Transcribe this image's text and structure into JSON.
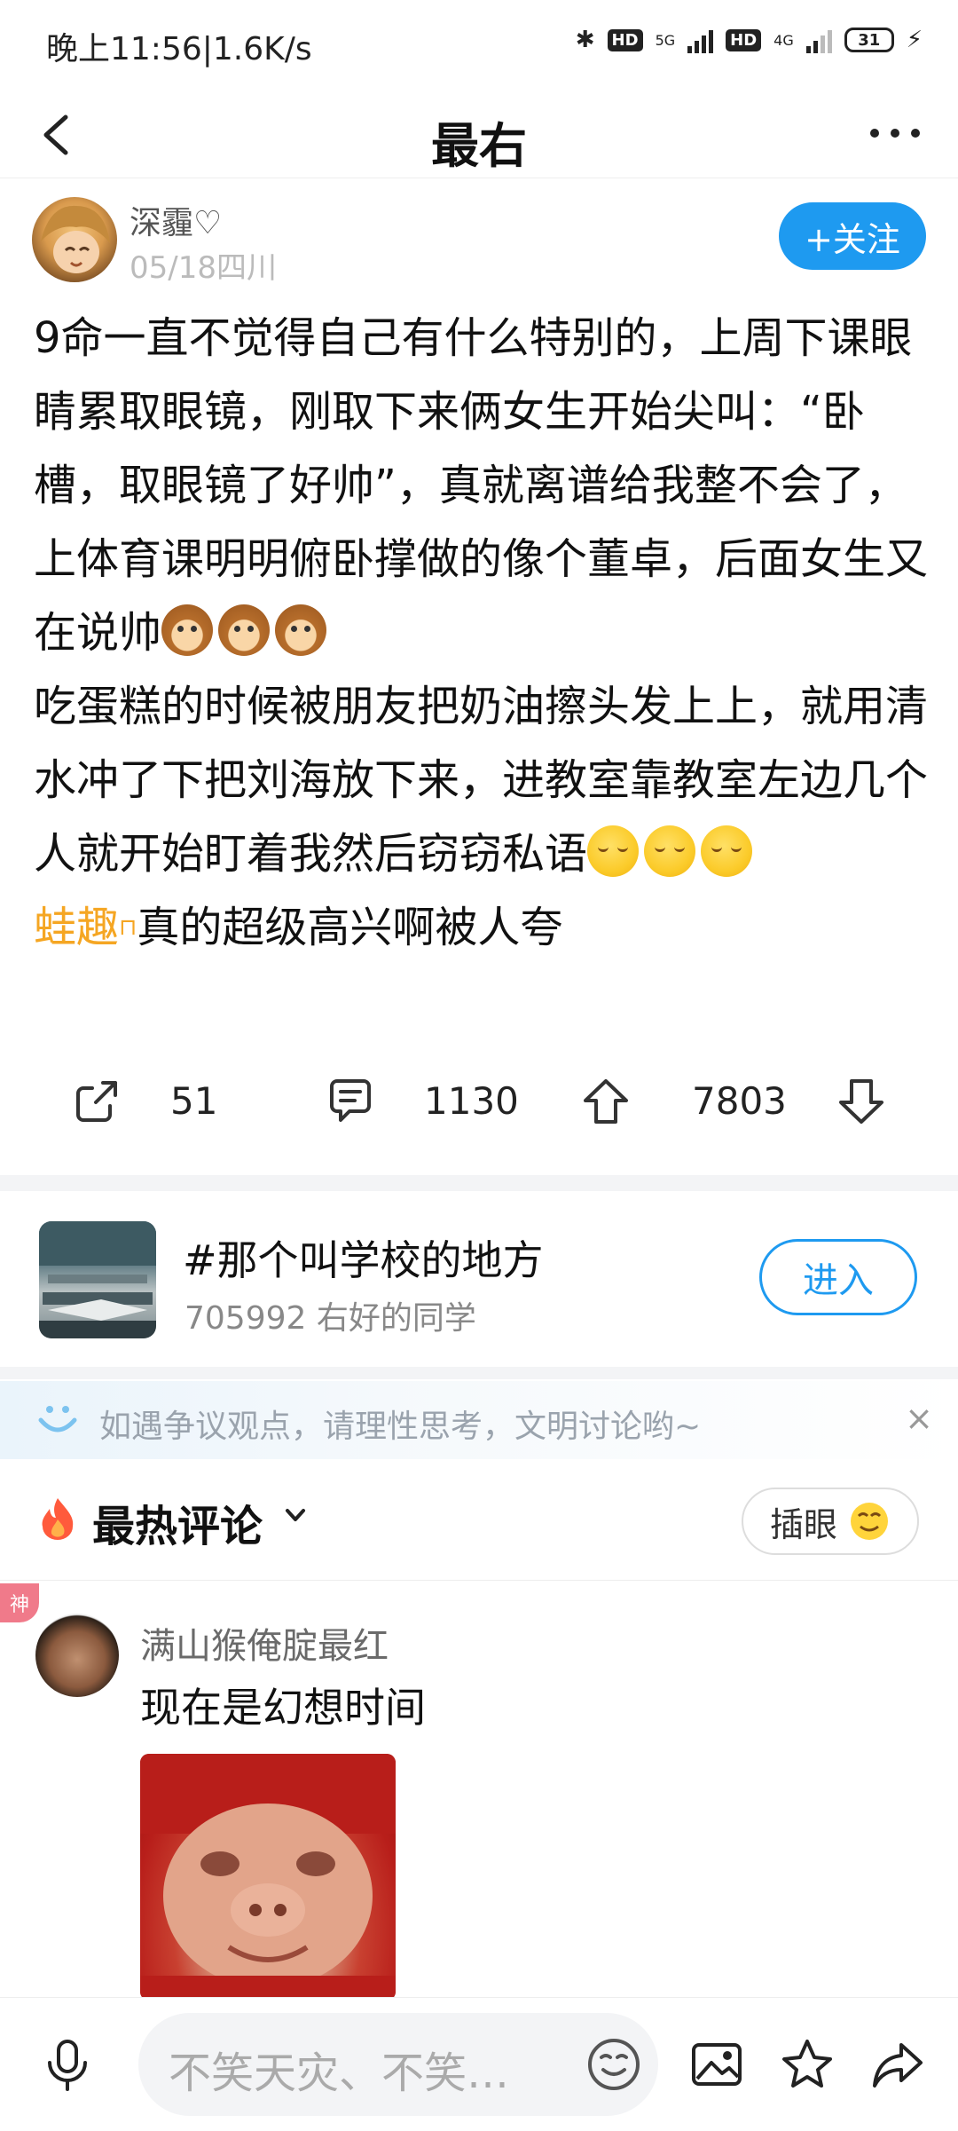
{
  "status_bar": {
    "left_text": "晚上11:56|1.6K/s",
    "net_5g": "5G",
    "net_4g": "4G",
    "hd_badge": "HD",
    "battery": "31"
  },
  "nav": {
    "title": "最右"
  },
  "post": {
    "username": "深霾♡",
    "meta": "05/18四川",
    "follow_label": "+关注",
    "paragraph1": "9命一直不觉得自己有什么特别的，上周下课眼睛累取眼镜，刚取下来俩女生开始尖叫：“卧槽，取眼镜了好帅”，真就离谱给我整不会了，上体育课明明俯卧撑做的像个董卓，后面女生又在说帅",
    "paragraph2": "吃蛋糕的时候被朋友把奶油擦头发上上，就用清水冲了下把刘海放下来，进教室靠教室左边几个人就开始盯着我然后窃窃私语",
    "tag": "蛙趣",
    "paragraph3": "真的超级高兴啊被人夸",
    "share_count": "51",
    "comment_count": "1130",
    "like_count": "7803"
  },
  "topic": {
    "title": "#那个叫学校的地方",
    "subtitle": "705992 右好的同学",
    "enter_label": "进入"
  },
  "tip": {
    "text": "如遇争议观点，请理性思考，文明讨论哟~",
    "close": "×"
  },
  "comments": {
    "title": "最热评论",
    "insert_label": "插眼",
    "god_badge": "神",
    "first": {
      "username": "满山猴俺腚最红",
      "text": "现在是幻想时间"
    }
  },
  "bottom": {
    "placeholder": "不笑天灾、不笑…"
  }
}
